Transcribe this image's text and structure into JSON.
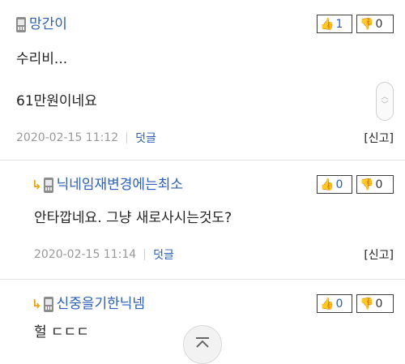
{
  "comments": [
    {
      "author": "망간이",
      "lines": [
        "수리비...",
        "61만원이네요"
      ],
      "timestamp": "2020-02-15 11:12",
      "reply_label": "덧글",
      "report_label": "[신고]",
      "upvotes": "1",
      "downvotes": "0"
    },
    {
      "author": "닉네임재변경에는최소",
      "lines": [
        "안타깝네요. 그냥 새로사시는것도?"
      ],
      "timestamp": "2020-02-15 11:14",
      "reply_label": "덧글",
      "report_label": "[신고]",
      "upvotes": "0",
      "downvotes": "0"
    },
    {
      "author": "신중을기한닉넴",
      "lines": [
        "헐 ㄷㄷㄷ"
      ],
      "upvotes": "0",
      "downvotes": "0"
    }
  ],
  "icons": {
    "device": "mobile-phone-icon",
    "reply_indicator": "reply-arrow-icon",
    "upvote": "thumbs-up-icon",
    "downvote": "thumbs-down-icon",
    "scroll_to_top": "chevron-up-icon"
  },
  "colors": {
    "author": "#2b5fb8",
    "reply_arrow": "#e7a21a",
    "meta_text": "#999999",
    "divider": "#e3e3e3"
  }
}
